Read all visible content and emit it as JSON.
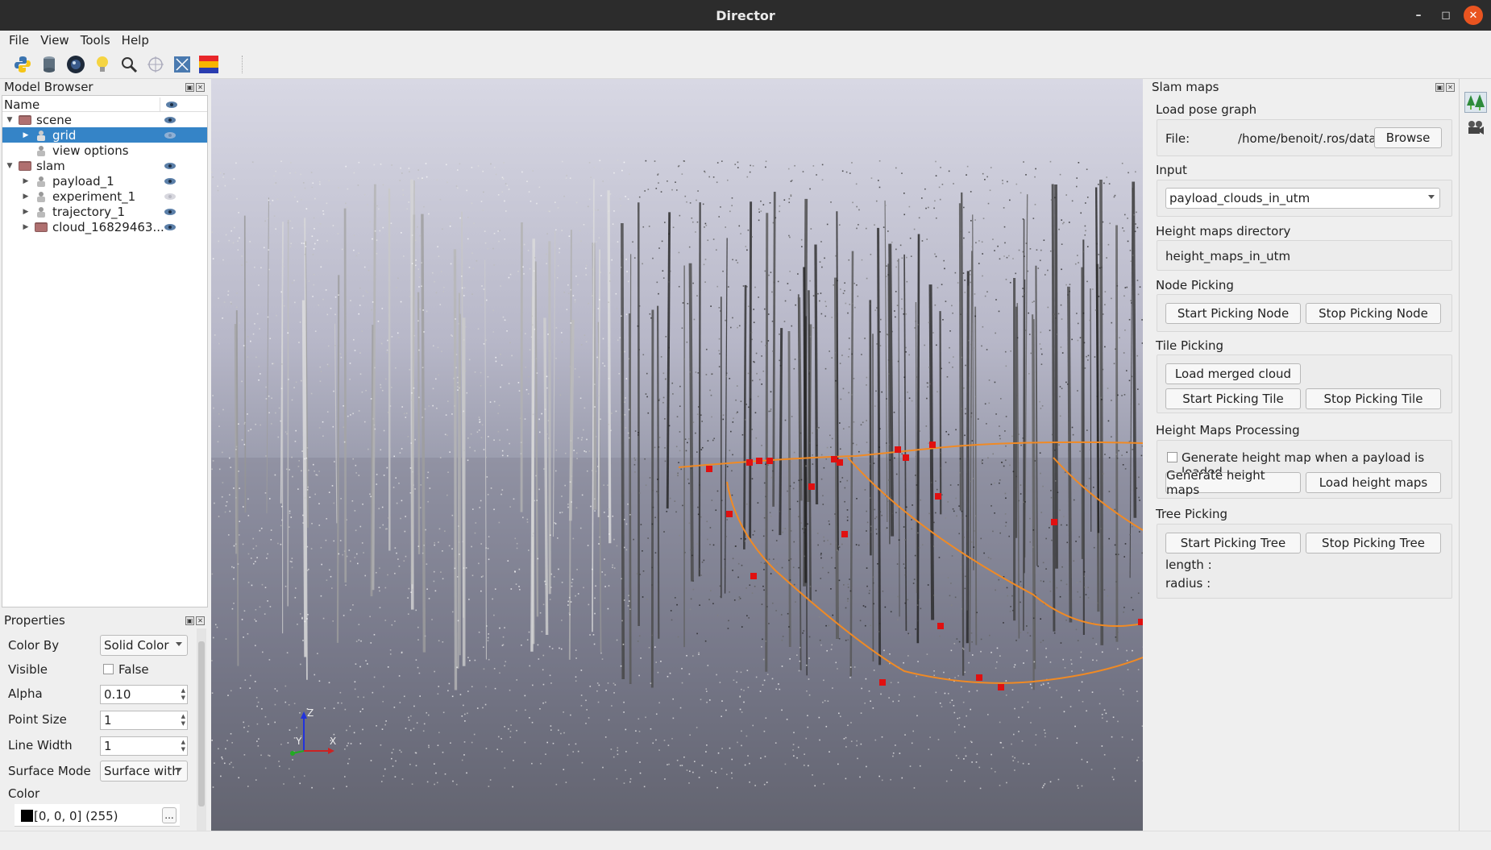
{
  "window": {
    "title": "Director"
  },
  "menu": [
    "File",
    "View",
    "Tools",
    "Help"
  ],
  "toolbar": [
    "python-icon",
    "database-icon",
    "camera-lens-icon",
    "lightbulb-icon",
    "zoom-icon",
    "crosshair-icon",
    "fit-view-icon",
    "colormap-icon"
  ],
  "model_browser": {
    "title": "Model Browser",
    "column_name": "Name",
    "items": [
      {
        "label": "scene",
        "level": 0,
        "expanded": true,
        "icon": "folder-icon",
        "visible": true
      },
      {
        "label": "grid",
        "level": 1,
        "expanded": false,
        "icon": "object-icon",
        "visible": false,
        "selected": true
      },
      {
        "label": "view options",
        "level": 1,
        "expanded": null,
        "icon": "object-icon",
        "visible": null
      },
      {
        "label": "slam",
        "level": 0,
        "expanded": true,
        "icon": "folder-icon",
        "visible": true
      },
      {
        "label": "payload_1",
        "level": 1,
        "expanded": false,
        "icon": "object-icon",
        "visible": true
      },
      {
        "label": "experiment_1",
        "level": 1,
        "expanded": false,
        "icon": "object-icon",
        "visible": false
      },
      {
        "label": "trajectory_1",
        "level": 1,
        "expanded": false,
        "icon": "object-icon",
        "visible": true
      },
      {
        "label": "cloud_16829463...",
        "level": 1,
        "expanded": false,
        "icon": "folder-icon",
        "visible": true
      }
    ]
  },
  "properties": {
    "title": "Properties",
    "color_by_label": "Color By",
    "color_by_value": "Solid Color",
    "visible_label": "Visible",
    "visible_value": "False",
    "alpha_label": "Alpha",
    "alpha_value": "0.10",
    "point_size_label": "Point Size",
    "point_size_value": "1",
    "line_width_label": "Line Width",
    "line_width_value": "1",
    "surface_mode_label": "Surface Mode",
    "surface_mode_value": "Surface with",
    "color_label": "Color",
    "color_value": "[0, 0, 0] (255)",
    "color_button": "..."
  },
  "axes": {
    "z": "Z",
    "y": "Y",
    "x": "X"
  },
  "slam_maps": {
    "title": "Slam maps",
    "load_pose_graph": "Load pose graph",
    "file_label": "File:",
    "file_path": "/home/benoit/.ros/data",
    "browse": "Browse",
    "input_label": "Input",
    "input_value": "payload_clouds_in_utm",
    "height_maps_dir_label": "Height maps directory",
    "height_maps_dir_value": "height_maps_in_utm",
    "node_picking_label": "Node Picking",
    "start_picking_node": "Start Picking Node",
    "stop_picking_node": "Stop Picking Node",
    "tile_picking_label": "Tile Picking",
    "load_merged_cloud": "Load merged cloud",
    "start_picking_tile": "Start Picking Tile",
    "stop_picking_tile": "Stop Picking Tile",
    "height_maps_processing_label": "Height Maps Processing",
    "generate_on_load_label": "Generate height map when a payload is loaded",
    "generate_height_maps": "Generate height maps",
    "load_height_maps": "Load height maps",
    "tree_picking_label": "Tree Picking",
    "start_picking_tree": "Start Picking Tree",
    "stop_picking_tree": "Stop Picking Tree",
    "length_label": "length :",
    "radius_label": "radius :"
  },
  "colors": {
    "selection": "#3584c7",
    "trajectory": "#f08a24",
    "node": "#e01010",
    "close": "#e95420"
  }
}
